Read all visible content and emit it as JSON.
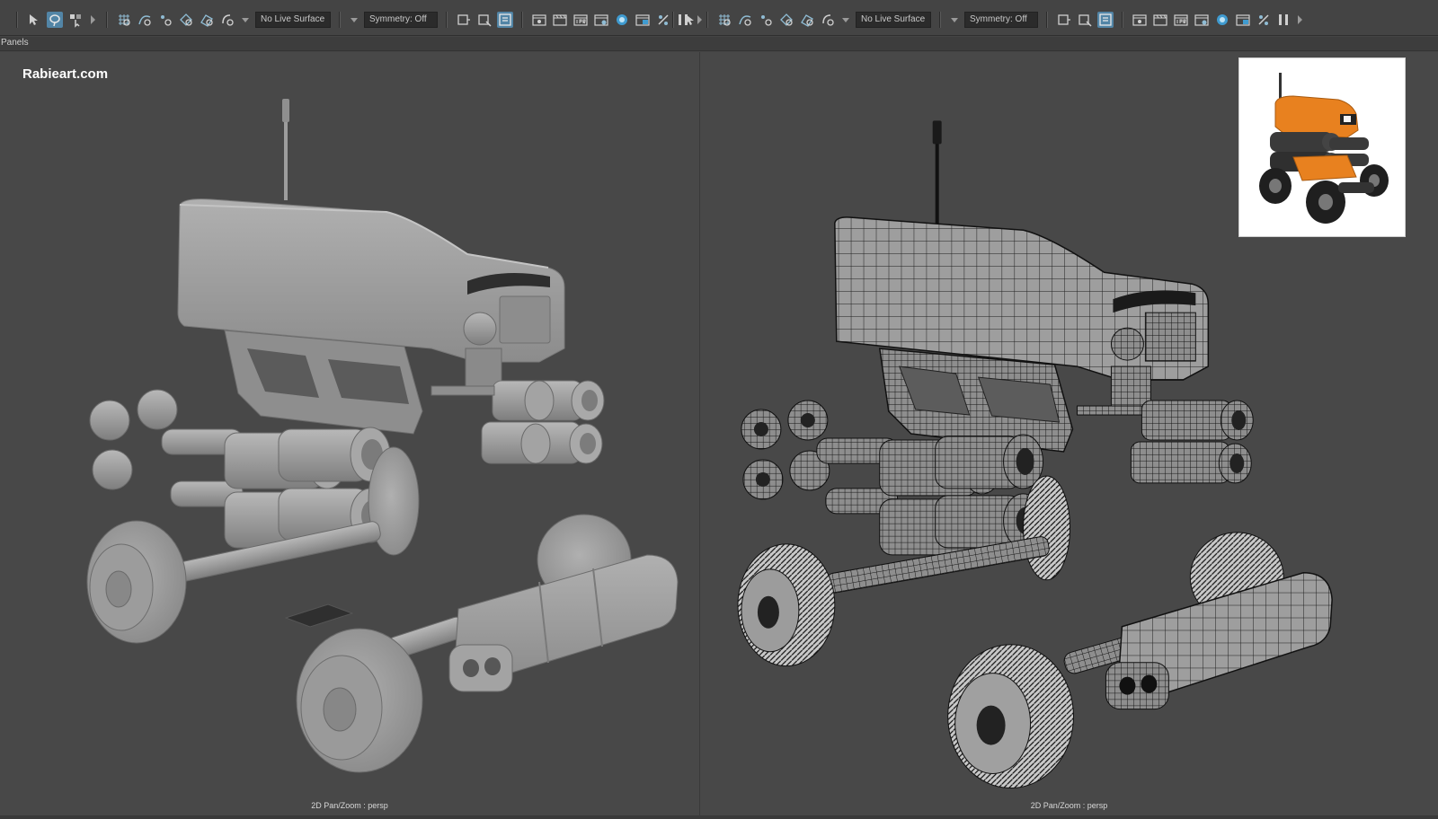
{
  "menu": {
    "panels": "Panels"
  },
  "toolbar_left": {
    "live_surface": "No Live Surface",
    "symmetry": "Symmetry: Off"
  },
  "toolbar_right": {
    "live_surface": "No Live Surface",
    "symmetry": "Symmetry: Off"
  },
  "viewport_left": {
    "watermark": "Rabieart.com",
    "status": "2D Pan/Zoom : persp",
    "shading": "smooth-shaded"
  },
  "viewport_right": {
    "status": "2D Pan/Zoom : persp",
    "shading": "wireframe-on-shaded"
  },
  "colors": {
    "viewport_bg": "#484848",
    "model_gray": "#9a9a9a",
    "wire": "#1a1a1a",
    "accent_orange": "#e8811f",
    "selected_icon": "#5285a6"
  },
  "icons": [
    "select-icon",
    "lasso-icon",
    "paint-select-icon",
    "snap-grid-icon",
    "snap-curve-icon",
    "snap-point-icon",
    "snap-view-icon",
    "snap-surface-icon",
    "history-icon",
    "render-icon",
    "ipr-icon",
    "render-settings-icon",
    "hypershade-icon",
    "pause-icon"
  ]
}
